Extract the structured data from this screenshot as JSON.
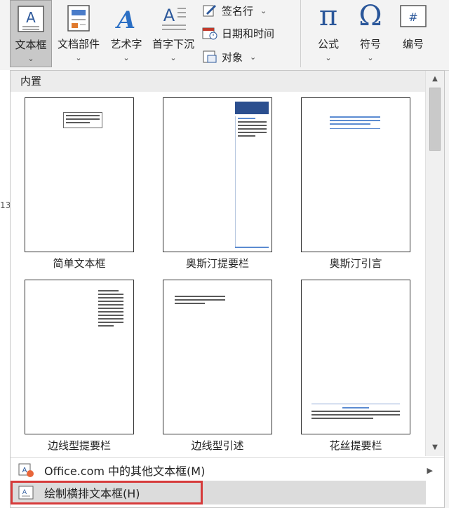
{
  "ribbon": {
    "buttons": [
      {
        "label": "文本框",
        "icon": "text-box-icon"
      },
      {
        "label": "文档部件",
        "icon": "quick-parts-icon"
      },
      {
        "label": "艺术字",
        "icon": "wordart-icon"
      },
      {
        "label": "首字下沉",
        "icon": "drop-cap-icon"
      }
    ],
    "small_buttons": [
      {
        "label": "签名行",
        "icon": "signature-line-icon"
      },
      {
        "label": "日期和时间",
        "icon": "date-time-icon"
      },
      {
        "label": "对象",
        "icon": "object-icon"
      }
    ],
    "symbols": [
      {
        "label": "公式",
        "glyph": "π",
        "icon": "equation-icon"
      },
      {
        "label": "符号",
        "glyph": "Ω",
        "icon": "symbol-icon"
      },
      {
        "label": "编号",
        "glyph": "#",
        "icon": "number-icon"
      }
    ]
  },
  "doc": {
    "line_num": "13"
  },
  "dropdown": {
    "section_title": "内置",
    "templates": [
      {
        "label": "简单文本框",
        "icon": "simple-text-box-thumbnail"
      },
      {
        "label": "奥斯汀提要栏",
        "icon": "austin-sidebar-thumbnail"
      },
      {
        "label": "奥斯汀引言",
        "icon": "austin-quote-thumbnail"
      },
      {
        "label": "边线型提要栏",
        "icon": "sideline-sidebar-thumbnail"
      },
      {
        "label": "边线型引述",
        "icon": "sideline-quote-thumbnail"
      },
      {
        "label": "花丝提要栏",
        "icon": "filigree-sidebar-thumbnail"
      }
    ],
    "more_label": "Office.com 中的其他文本框(M)",
    "draw_label": "绘制横排文本框(H)"
  },
  "colors": {
    "accent": "#2b579a",
    "highlight": "#d63b3b",
    "hover": "#c8c8c8"
  }
}
